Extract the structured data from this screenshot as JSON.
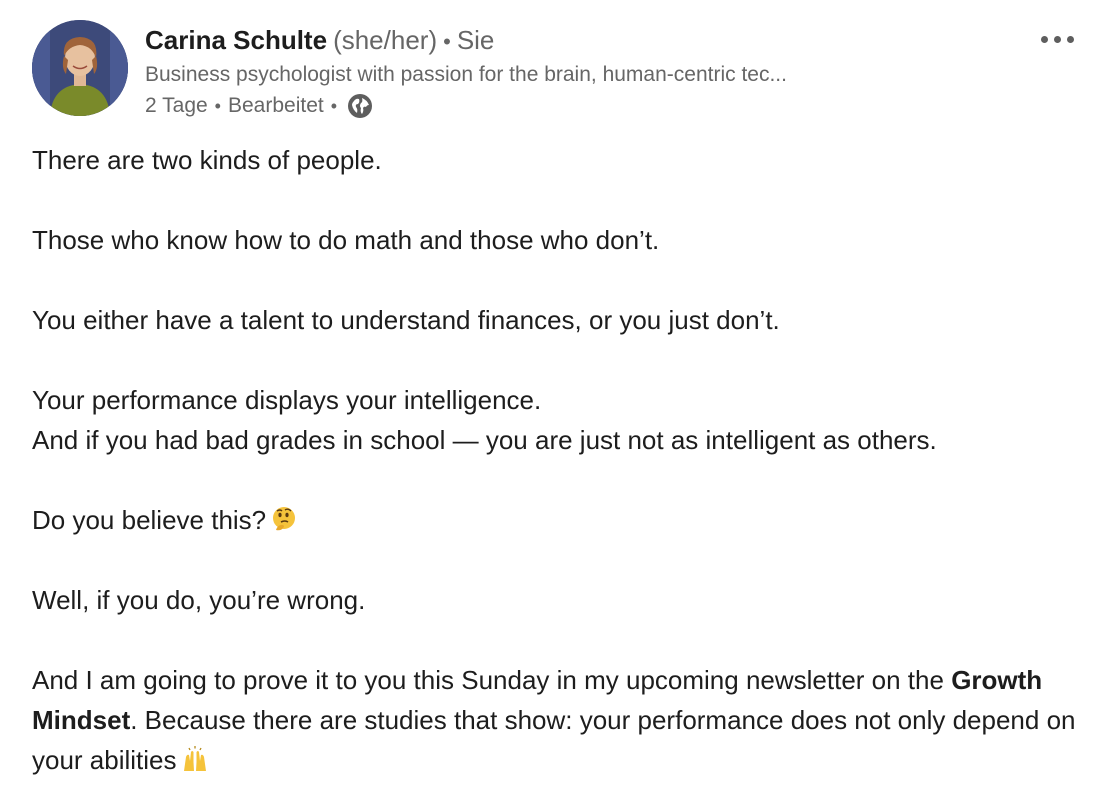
{
  "author": {
    "name": "Carina Schulte",
    "pronouns": "(she/her)",
    "separator": "•",
    "relation": "Sie",
    "headline": "Business psychologist with passion for the brain, human-centric tec...",
    "time": "2 Tage",
    "edited": "Bearbeitet",
    "visibility_icon": "globe-icon"
  },
  "menu": {
    "icon": "more-options-icon"
  },
  "post": {
    "line1": "There are two kinds of people.",
    "line2": "Those who know how to do math and those who don’t.",
    "line3": "You either have a talent to understand finances, or you just don’t.",
    "line4": "Your performance displays your intelligence.",
    "line5": "And if you had bad grades in school — you are just not as intelligent as others.",
    "line6": "Do you believe this?",
    "line6_emoji": "thinking-face-emoji",
    "line7": "Well, if you do, you’re wrong.",
    "line8_part1": "And I am going to prove it to you this Sunday in my upcoming newsletter on the",
    "line8_bold": "Growth Mindset",
    "line8_part2": ". Because there are studies that show: your performance does not only depend on your abilities",
    "line8_emoji": "raising-hands-emoji"
  },
  "colors": {
    "text": "#1d1d1d",
    "muted": "#666666",
    "avatar_bg": "#3d4a7a",
    "shirt": "#7a8a2a",
    "emoji_yellow": "#f5c33b"
  }
}
